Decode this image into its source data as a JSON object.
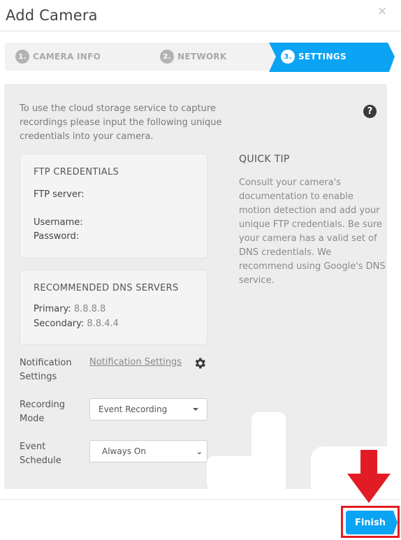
{
  "header": {
    "title": "Add Camera",
    "close_icon": "close-icon"
  },
  "steps": [
    {
      "number": "1.",
      "label": "CAMERA INFO",
      "active": false
    },
    {
      "number": "2.",
      "label": "NETWORK",
      "active": false
    },
    {
      "number": "3.",
      "label": "SETTINGS",
      "active": true
    }
  ],
  "colors": {
    "accent": "#0ba3f3",
    "panel_bg": "#ededed",
    "annotation_red": "#e21c24"
  },
  "intro_text": "To use the cloud storage service to capture recordings please input the following unique credentials into your camera.",
  "help_icon": "?",
  "ftp": {
    "title": "FTP CREDENTIALS",
    "server_label": "FTP server:",
    "server_value": "",
    "username_label": "Username:",
    "username_value": "",
    "password_label": "Password:",
    "password_value": ""
  },
  "dns": {
    "title": "RECOMMENDED DNS SERVERS",
    "primary_label": "Primary:",
    "primary_value": "8.8.8.8",
    "secondary_label": "Secondary:",
    "secondary_value": "8.8.4.4"
  },
  "quick_tip": {
    "title": "QUICK TIP",
    "text": "Consult your camera's documentation to enable motion detection and add your unique FTP credentials. Be sure your camera has a valid set of DNS credentials. We recommend using Google's DNS service."
  },
  "form": {
    "notification_label": "Notification Settings",
    "notification_link": "Notification Settings",
    "recording_mode_label": "Recording Mode",
    "recording_mode_value": "Event Recording",
    "event_schedule_label": "Event Schedule",
    "event_schedule_value": "Always On"
  },
  "footer": {
    "finish_label": "Finish"
  }
}
